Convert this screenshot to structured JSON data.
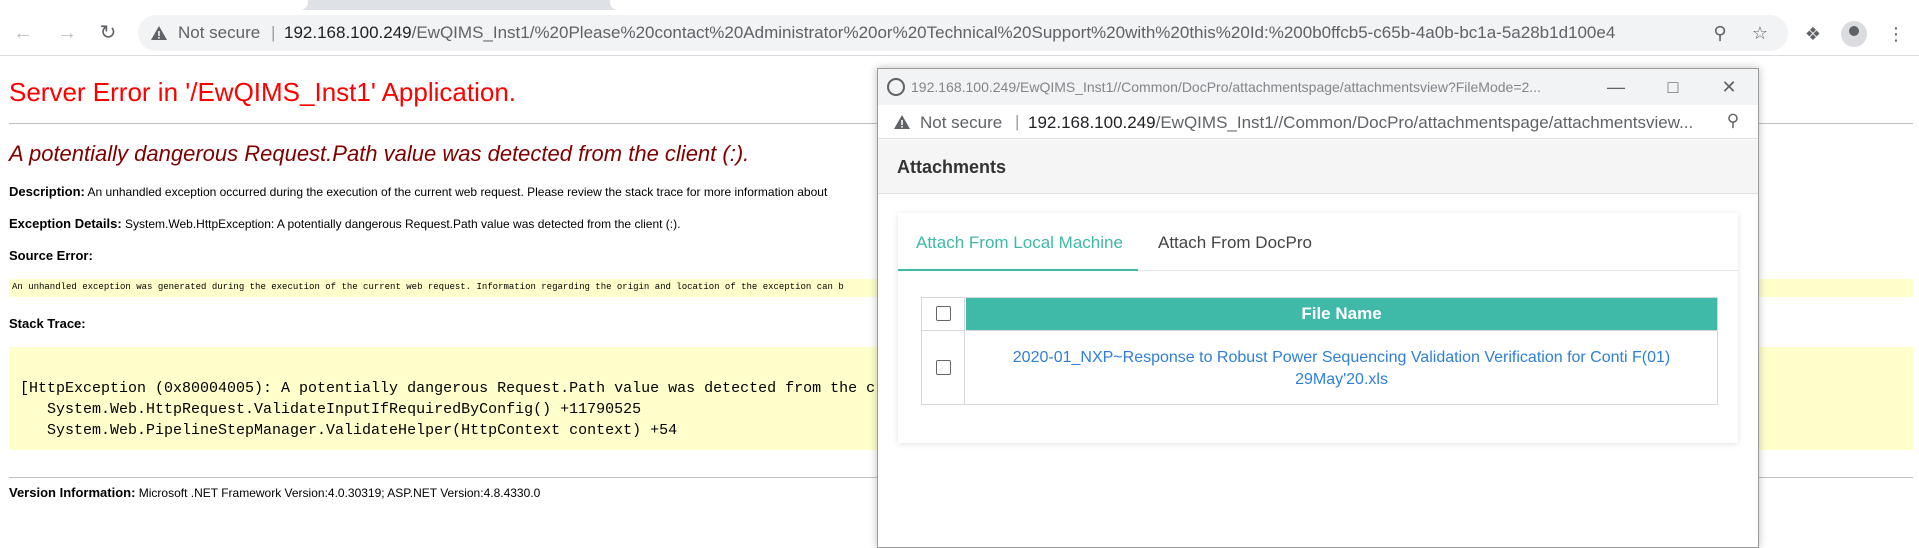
{
  "browser": {
    "not_secure": "Not secure",
    "url_host": "192.168.100.249",
    "url_path": "/EwQIMS_Inst1/%20Please%20contact%20Administrator%20or%20Technical%20Support%20with%20this%20Id:%200b0ffcb5-c65b-4a0b-bc1a-5a28b1d100e4",
    "icons": [
      "back-icon",
      "forward-icon",
      "reload-icon",
      "warning-icon",
      "zoom-icon",
      "star-icon",
      "extensions-icon",
      "profile-icon",
      "menu-icon"
    ]
  },
  "error_page": {
    "title": "Server Error in '/EwQIMS_Inst1' Application.",
    "subtitle": "A potentially dangerous Request.Path value was detected from the client (:).",
    "description_label": "Description:",
    "description_text": " An unhandled exception occurred during the execution of the current web request. Please review the stack trace for more information about",
    "exception_label": "Exception Details:",
    "exception_text": " System.Web.HttpException: A potentially dangerous Request.Path value was detected from the client (:).",
    "source_error_label": "Source Error:",
    "source_error_text": "An unhandled exception was generated during the execution of the current web request. Information regarding the origin and location of the exception can b",
    "stack_trace_label": "Stack Trace:",
    "stack_lines": [
      "[HttpException (0x80004005): A potentially dangerous Request.Path value was detected from the c",
      "   System.Web.HttpRequest.ValidateInputIfRequiredByConfig() +11790525",
      "   System.Web.PipelineStepManager.ValidateHelper(HttpContext context) +54"
    ],
    "version_label": "Version Information:",
    "version_text": " Microsoft .NET Framework Version:4.0.30319; ASP.NET Version:4.8.4330.0"
  },
  "popup": {
    "window_title": "192.168.100.249/EwQIMS_Inst1//Common/DocPro/attachmentspage/attachmentsview?FileMode=2...",
    "not_secure": "Not secure",
    "url_host": "192.168.100.249",
    "url_path": "/EwQIMS_Inst1//Common/DocPro/attachmentspage/attachmentsview...",
    "heading": "Attachments",
    "tabs": [
      {
        "label": "Attach From Local Machine",
        "active": true
      },
      {
        "label": "Attach From DocPro",
        "active": false
      }
    ],
    "table": {
      "header": "File Name",
      "rows": [
        {
          "file_name": "2020-01_NXP~Response to Robust Power Sequencing Validation Verification for Conti F(01) 29May'20.xls"
        }
      ]
    }
  },
  "colors": {
    "accent_teal": "#3fb9a8",
    "error_red": "#ff0000",
    "error_maroon": "#800000",
    "link_blue": "#2f7fd9",
    "code_bg": "#ffffcc"
  }
}
